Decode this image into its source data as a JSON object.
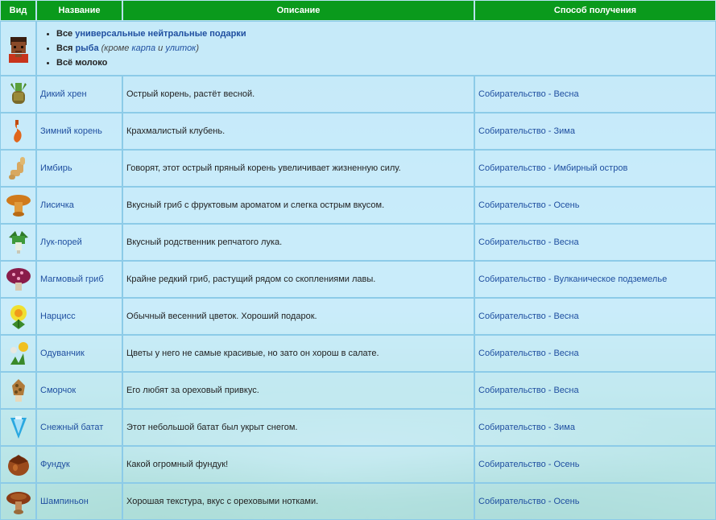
{
  "headers": {
    "view": "Вид",
    "name": "Название",
    "description": "Описание",
    "source": "Способ получения"
  },
  "intro": {
    "icon": "villager-portrait-icon",
    "lines": [
      {
        "prefix": "Все",
        "link": "универсальные нейтральные подарки",
        "note_open": "",
        "note_link1": "",
        "note_mid": "",
        "note_link2": "",
        "note_close": ""
      },
      {
        "prefix": "Вся",
        "link": "рыба",
        "note_open": "(кроме",
        "note_link1": "карпа",
        "note_mid": "и",
        "note_link2": "улиток",
        "note_close": ")"
      },
      {
        "prefix": "Всё молоко",
        "link": "",
        "note_open": "",
        "note_link1": "",
        "note_mid": "",
        "note_link2": "",
        "note_close": ""
      }
    ]
  },
  "rows": [
    {
      "icon": "horseradish-icon",
      "name": "Дикий хрен",
      "description": "Острый корень, растёт весной.",
      "source": "Собирательство - Весна"
    },
    {
      "icon": "winter-root-icon",
      "name": "Зимний корень",
      "description": "Крахмалистый клубень.",
      "source": "Собирательство - Зима"
    },
    {
      "icon": "ginger-icon",
      "name": "Имбирь",
      "description": "Говорят, этот острый пряный корень увеличивает жизненную силу.",
      "source": "Собирательство - Имбирный остров"
    },
    {
      "icon": "chanterelle-icon",
      "name": "Лисичка",
      "description": "Вкусный гриб с фруктовым ароматом и слегка острым вкусом.",
      "source": "Собирательство - Осень"
    },
    {
      "icon": "leek-icon",
      "name": "Лук-порей",
      "description": "Вкусный родственник репчатого лука.",
      "source": "Собирательство - Весна"
    },
    {
      "icon": "magma-cap-icon",
      "name": "Магмовый гриб",
      "description": "Крайне редкий гриб, растущий рядом со скоплениями лавы.",
      "source": "Собирательство - Вулканическое подземелье"
    },
    {
      "icon": "daffodil-icon",
      "name": "Нарцисс",
      "description": "Обычный весенний цветок. Хороший подарок.",
      "source": "Собирательство - Весна"
    },
    {
      "icon": "dandelion-icon",
      "name": "Одуванчик",
      "description": "Цветы у него не самые красивые, но зато он хорош в салате.",
      "source": "Собирательство - Весна"
    },
    {
      "icon": "morel-icon",
      "name": "Сморчок",
      "description": "Его любят за ореховый привкус.",
      "source": "Собирательство - Весна"
    },
    {
      "icon": "snow-yam-icon",
      "name": "Снежный батат",
      "description": "Этот небольшой батат был укрыт снегом.",
      "source": "Собирательство - Зима"
    },
    {
      "icon": "hazelnut-icon",
      "name": "Фундук",
      "description": "Какой огромный фундук!",
      "source": "Собирательство - Осень"
    },
    {
      "icon": "common-mushroom-icon",
      "name": "Шампиньон",
      "description": "Хорошая текстура, вкус с ореховыми нотками.",
      "source": "Собирательство - Осень"
    }
  ]
}
